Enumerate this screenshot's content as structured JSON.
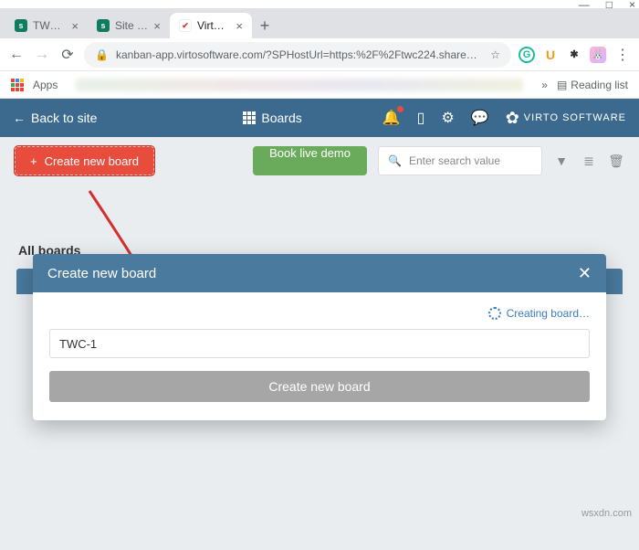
{
  "window": {
    "min": "—",
    "max": "□",
    "close": "×"
  },
  "tabs": [
    {
      "title": "TWC - H",
      "fav": "s"
    },
    {
      "title": "Site Con",
      "fav": "s"
    },
    {
      "title": "Virto Ka",
      "fav": "v",
      "active": true
    }
  ],
  "newtab_icon": "+",
  "addr": {
    "back": "←",
    "forward": "→",
    "reload": "⟳",
    "lock": "🔒",
    "url": "kanban-app.virtosoftware.com/?SPHostUrl=https:%2F%2Ftwc224.share…",
    "star": "☆"
  },
  "ext": {
    "g": "G",
    "u": "U",
    "puzzle": "✱",
    "rabbit": "🐰",
    "menu": "⋮"
  },
  "bookmarks": {
    "apps": "Apps",
    "more": "»",
    "reading": "Reading list",
    "reading_icon": "▤"
  },
  "header": {
    "back": "Back to site",
    "back_icon": "←",
    "boards": "Boards",
    "bell": "🔔",
    "book": "▯",
    "gear": "⚙",
    "chat": "💬",
    "logo_mark": "✿",
    "logo_text": "VIRTO SOFTWARE"
  },
  "toolbar": {
    "create_icon": "+",
    "create_label": "Create new board",
    "demo_label": "Book live demo",
    "search_icon": "🔍",
    "search_placeholder": "Enter search value",
    "filter": "▼",
    "list": "≣",
    "trash": "🗑"
  },
  "content": {
    "section": "All boards"
  },
  "modal": {
    "title": "Create new board",
    "close": "✕",
    "status": "Creating board…",
    "input_value": "TWC-1",
    "submit_label": "Create new board"
  },
  "watermark": "wsxdn.com"
}
